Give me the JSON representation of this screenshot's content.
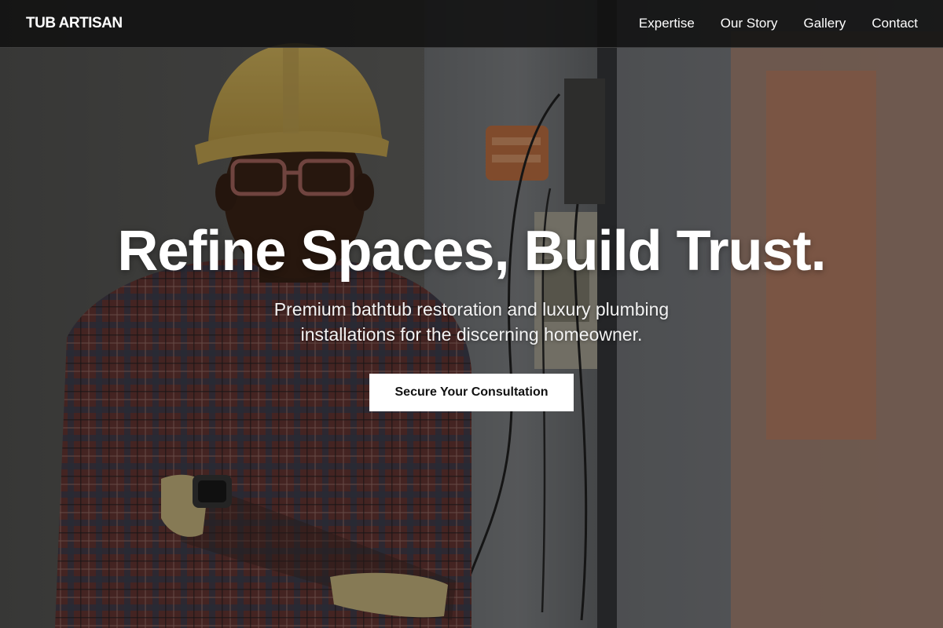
{
  "brand": {
    "name": "TUB ARTISAN"
  },
  "nav": {
    "items": [
      {
        "label": "Expertise"
      },
      {
        "label": "Our Story"
      },
      {
        "label": "Gallery"
      },
      {
        "label": "Contact"
      }
    ]
  },
  "hero": {
    "headline": "Refine Spaces, Build Trust.",
    "subheadline": "Premium bathtub restoration and luxury plumbing installations for the discerning homeowner.",
    "cta_label": "Secure Your Consultation"
  },
  "colors": {
    "nav_background": "#111111",
    "text": "#ffffff",
    "cta_background": "#ffffff",
    "cta_text": "#111111"
  }
}
